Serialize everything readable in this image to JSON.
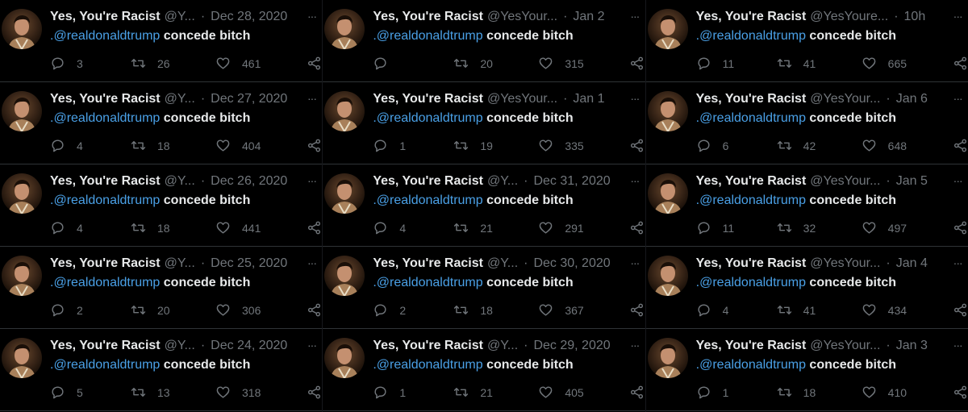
{
  "colors": {
    "background": "#000000",
    "text": "#e7e9ea",
    "muted": "#71767b",
    "mention": "#4aa0e6",
    "divider": "#2f3336"
  },
  "icons": {
    "reply": "reply-icon",
    "retweet": "retweet-icon",
    "like": "heart-icon",
    "share": "share-icon",
    "more": "more-icon"
  },
  "columns": [
    {
      "tweets": [
        {
          "name": "Yes, You're Racist",
          "handle": "@Y...",
          "dot": "·",
          "date": "Dec 28, 2020",
          "more": "···",
          "mention": ".@realdonaldtrump",
          "body": "concede bitch",
          "replies": "3",
          "retweets": "26",
          "likes": "461"
        },
        {
          "name": "Yes, You're Racist",
          "handle": "@Y...",
          "dot": "·",
          "date": "Dec 27, 2020",
          "more": "···",
          "mention": ".@realdonaldtrump",
          "body": "concede bitch",
          "replies": "4",
          "retweets": "18",
          "likes": "404"
        },
        {
          "name": "Yes, You're Racist",
          "handle": "@Y...",
          "dot": "·",
          "date": "Dec 26, 2020",
          "more": "···",
          "mention": ".@realdonaldtrump",
          "body": "concede bitch",
          "replies": "4",
          "retweets": "18",
          "likes": "441"
        },
        {
          "name": "Yes, You're Racist",
          "handle": "@Y...",
          "dot": "·",
          "date": "Dec 25, 2020",
          "more": "···",
          "mention": ".@realdonaldtrump",
          "body": "concede bitch",
          "replies": "2",
          "retweets": "20",
          "likes": "306"
        },
        {
          "name": "Yes, You're Racist",
          "handle": "@Y...",
          "dot": "·",
          "date": "Dec 24, 2020",
          "more": "···",
          "mention": ".@realdonaldtrump",
          "body": "concede bitch",
          "replies": "5",
          "retweets": "13",
          "likes": "318"
        }
      ]
    },
    {
      "tweets": [
        {
          "name": "Yes, You're Racist",
          "handle": "@YesYour...",
          "dot": "·",
          "date": "Jan 2",
          "more": "···",
          "mention": ".@realdonaldtrump",
          "body": "concede bitch",
          "replies": "",
          "retweets": "20",
          "likes": "315"
        },
        {
          "name": "Yes, You're Racist",
          "handle": "@YesYour...",
          "dot": "·",
          "date": "Jan 1",
          "more": "···",
          "mention": ".@realdonaldtrump",
          "body": "concede bitch",
          "replies": "1",
          "retweets": "19",
          "likes": "335"
        },
        {
          "name": "Yes, You're Racist",
          "handle": "@Y...",
          "dot": "·",
          "date": "Dec 31, 2020",
          "more": "···",
          "mention": ".@realdonaldtrump",
          "body": "concede bitch",
          "replies": "4",
          "retweets": "21",
          "likes": "291"
        },
        {
          "name": "Yes, You're Racist",
          "handle": "@Y...",
          "dot": "·",
          "date": "Dec 30, 2020",
          "more": "···",
          "mention": ".@realdonaldtrump",
          "body": "concede bitch",
          "replies": "2",
          "retweets": "18",
          "likes": "367"
        },
        {
          "name": "Yes, You're Racist",
          "handle": "@Y...",
          "dot": "·",
          "date": "Dec 29, 2020",
          "more": "···",
          "mention": ".@realdonaldtrump",
          "body": "concede bitch",
          "replies": "1",
          "retweets": "21",
          "likes": "405"
        }
      ]
    },
    {
      "tweets": [
        {
          "name": "Yes, You're Racist",
          "handle": "@YesYoure...",
          "dot": "·",
          "date": "10h",
          "more": "···",
          "mention": ".@realdonaldtrump",
          "body": "concede bitch",
          "replies": "11",
          "retweets": "41",
          "likes": "665"
        },
        {
          "name": "Yes, You're Racist",
          "handle": "@YesYour...",
          "dot": "·",
          "date": "Jan 6",
          "more": "···",
          "mention": ".@realdonaldtrump",
          "body": "concede bitch",
          "replies": "6",
          "retweets": "42",
          "likes": "648"
        },
        {
          "name": "Yes, You're Racist",
          "handle": "@YesYour...",
          "dot": "·",
          "date": "Jan 5",
          "more": "···",
          "mention": ".@realdonaldtrump",
          "body": "concede bitch",
          "replies": "11",
          "retweets": "32",
          "likes": "497"
        },
        {
          "name": "Yes, You're Racist",
          "handle": "@YesYour...",
          "dot": "·",
          "date": "Jan 4",
          "more": "···",
          "mention": ".@realdonaldtrump",
          "body": "concede bitch",
          "replies": "4",
          "retweets": "41",
          "likes": "434"
        },
        {
          "name": "Yes, You're Racist",
          "handle": "@YesYour...",
          "dot": "·",
          "date": "Jan 3",
          "more": "···",
          "mention": ".@realdonaldtrump",
          "body": "concede bitch",
          "replies": "1",
          "retweets": "18",
          "likes": "410"
        }
      ]
    }
  ]
}
